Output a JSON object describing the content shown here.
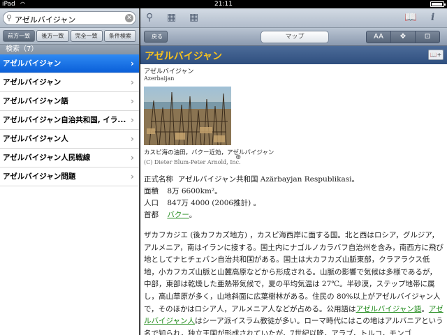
{
  "status": {
    "carrier": "iPad",
    "time": "21:11"
  },
  "search": {
    "value": "アゼルバイジャン"
  },
  "scope": [
    "前方一致",
    "後方一致",
    "完全一致",
    "条件検索"
  ],
  "list_header": "検索（7）",
  "results": [
    "アゼルバイジャン",
    "アゼルバイジャン",
    "アゼルバイジャン語",
    "アゼルバイジャン自治共和国, イラ...",
    "アゼルバイジャン人",
    "アゼルバイジャン人民戦線",
    "アゼルバイジャン問題"
  ],
  "nav": {
    "back": "戻る",
    "map": "マップ",
    "font_size": "AA"
  },
  "article": {
    "title": "アゼルバイジャン",
    "word": "アゼルバイジャン",
    "roman": "Azerbaijan",
    "caption": "カスピ海の油田，バクー近効，アゼルバイジャン",
    "credit": "(C) Dieter Blum-Peter Arnold, Inc.",
    "official_label": "正式名称",
    "official_value": "アゼルバイジャン共和国 Azärbayjan Respublikasi。",
    "area_label": "面積",
    "area_value": "8万 6600km²。",
    "pop_label": "人口",
    "pop_value": "847万 4000 (2006推計) 。",
    "capital_label": "首都",
    "capital_value": "バクー",
    "capital_suffix": "。",
    "para1": "ザカフカジエ (後カフカズ地方) ，カスピ海西岸に面する国。北と西はロシア，グルジア，アルメニア，南はイランに接する。国土内にナゴルノカラバフ自治州を含み，南西方に飛び地としてナヒチェバン自治共和国がある。国土は大カフカズ山脈東部，クラアラクス低地，小カフカズ山脈と山麓高原などから形成される。山脈の影響で気候は多様であるが，中部，東部は乾燥した亜熱帯気候で，夏の平均気温は 27℃。半砂漠，ステップ地帯に属し，高山草原が多く，山地斜面に広葉樹林がある。住民の 80%以上がアゼルバイジャン人で，そのほかはロシア人，アルメニア人などが占める。公用語は",
    "link_lang": "アゼルバイジャン語",
    "para_mid": "。",
    "link_people": "アゼルバイジャン人",
    "para2": "はシーア派イスラム教徒が多い。ローマ時代にはこの地はアルバニアという名で知られ，独立王国が形成されていたが，7世紀以降，アラブ，トルコ，モンゴ"
  }
}
